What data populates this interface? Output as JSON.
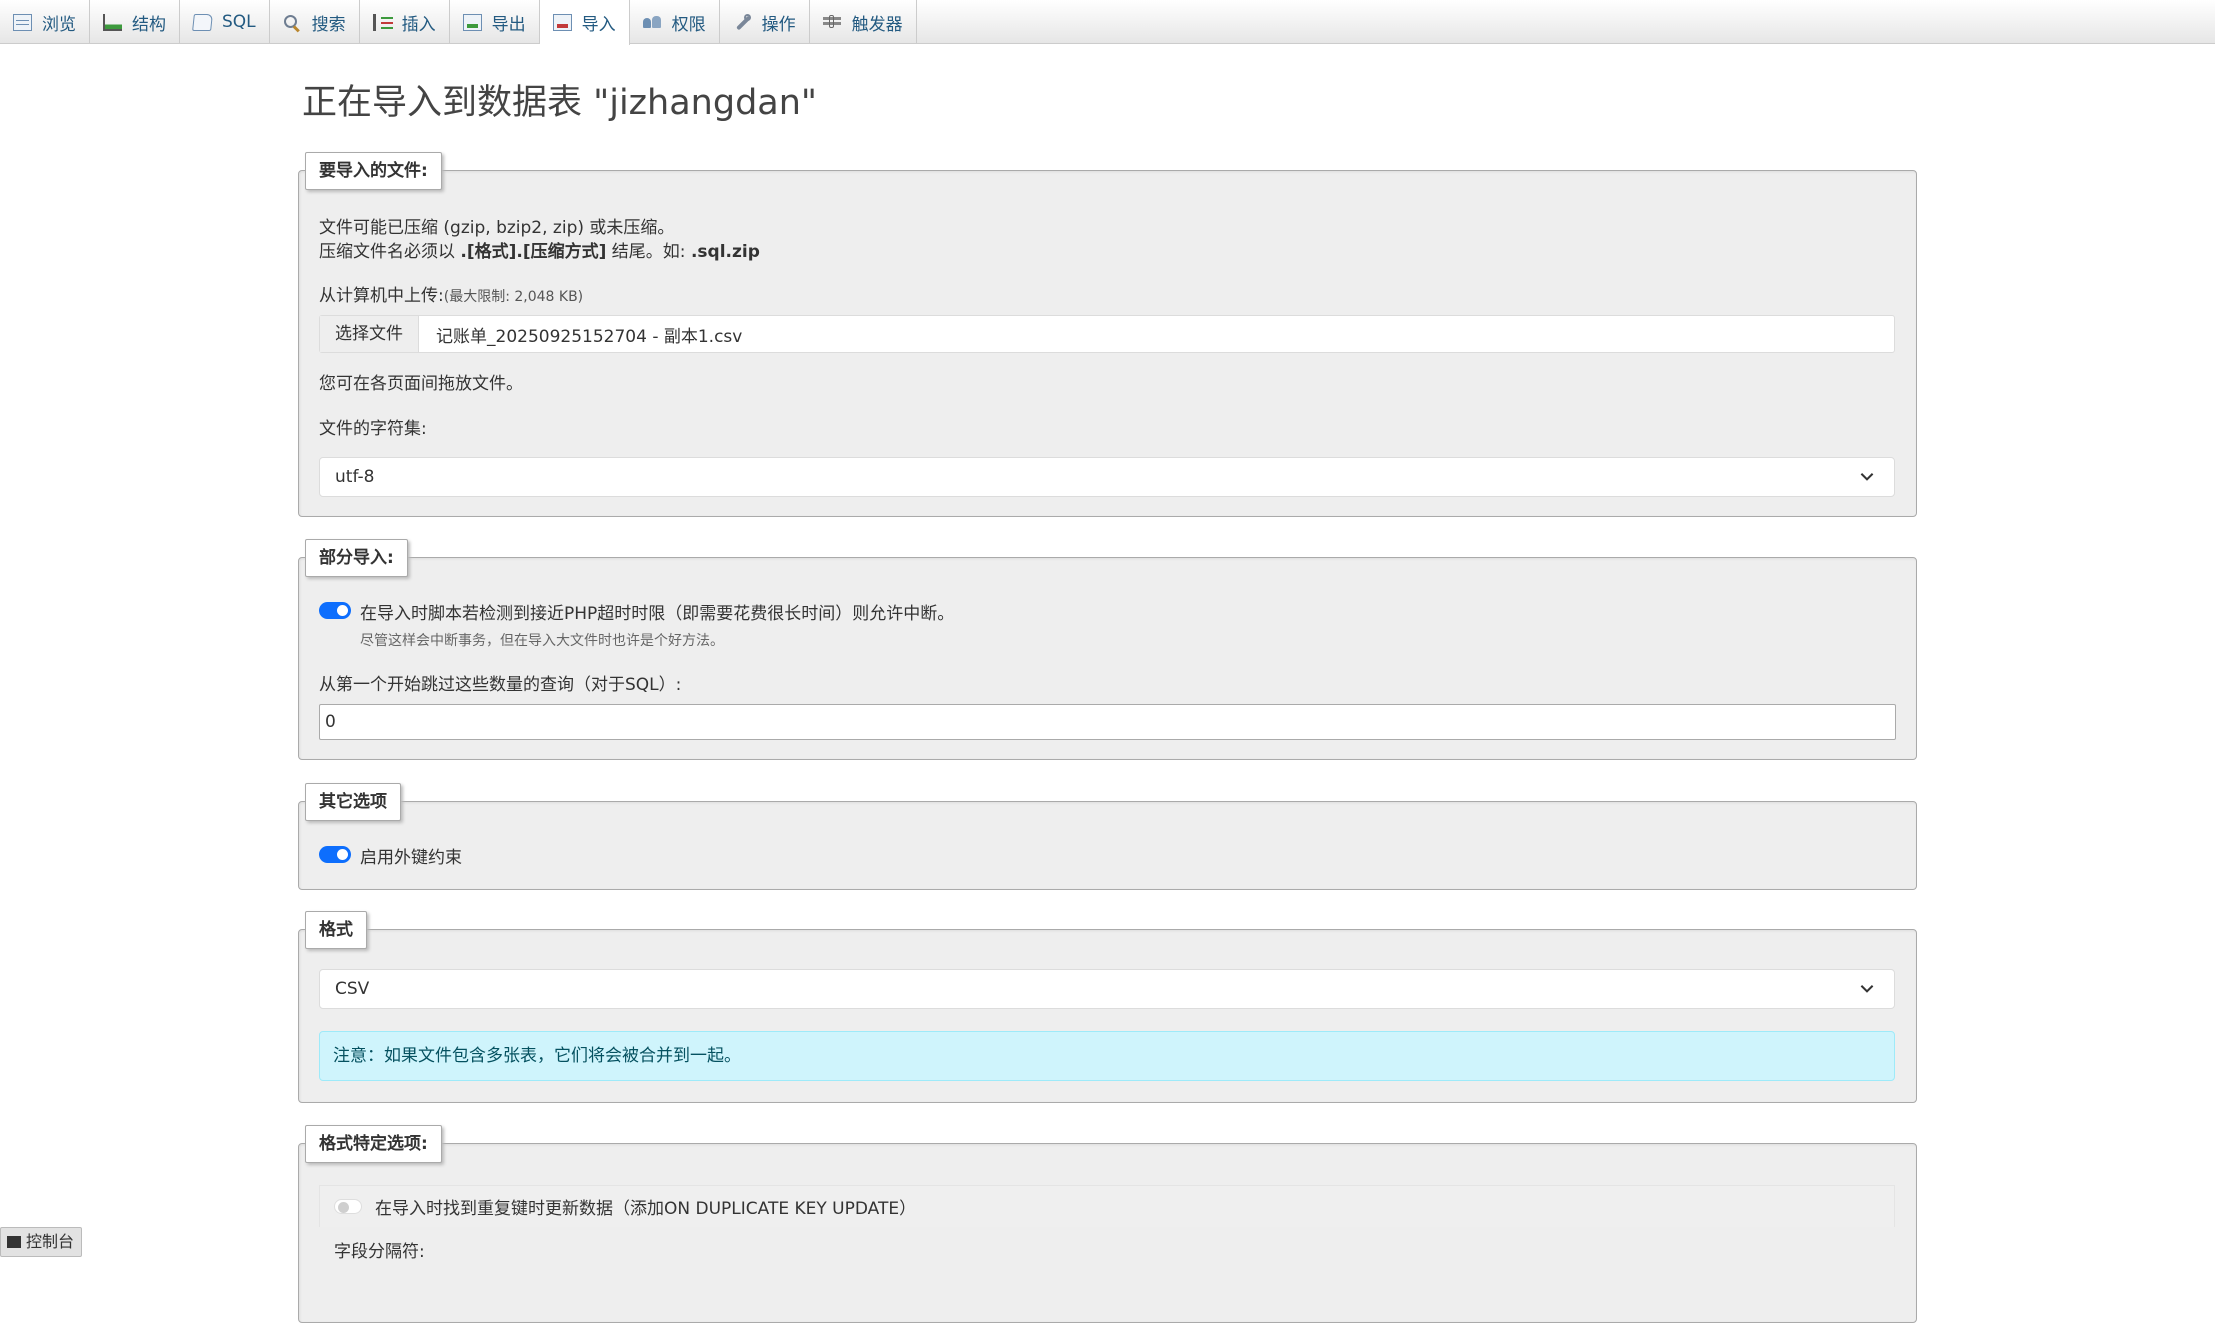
{
  "tabs": [
    {
      "label": "浏览",
      "icon": "browse-icon"
    },
    {
      "label": "结构",
      "icon": "structure-icon"
    },
    {
      "label": "SQL",
      "icon": "sql-icon"
    },
    {
      "label": "搜索",
      "icon": "search-icon"
    },
    {
      "label": "插入",
      "icon": "insert-icon"
    },
    {
      "label": "导出",
      "icon": "export-icon"
    },
    {
      "label": "导入",
      "icon": "import-icon",
      "active": true
    },
    {
      "label": "权限",
      "icon": "privileges-icon"
    },
    {
      "label": "操作",
      "icon": "operations-icon"
    },
    {
      "label": "触发器",
      "icon": "triggers-icon"
    }
  ],
  "page_title": "正在导入到数据表 \"jizhangdan\"",
  "file_section": {
    "legend": "要导入的文件:",
    "line1": "文件可能已压缩 (gzip, bzip2, zip) 或未压缩。",
    "line2_prefix": "压缩文件名必须以 ",
    "line2_bold1": ".[格式].[压缩方式]",
    "line2_mid": " 结尾。如: ",
    "line2_bold2": ".sql.zip",
    "upload_label": "从计算机中上传:",
    "upload_limit": "(最大限制: 2,048 KB)",
    "choose_file_button": "选择文件",
    "file_name": "记账单_20250925152704 - 副本1.csv",
    "drag_hint": "您可在各页面间拖放文件。",
    "charset_label": "文件的字符集:",
    "charset_value": "utf-8"
  },
  "partial_section": {
    "legend": "部分导入:",
    "allow_interrupt": "在导入时脚本若检测到接近PHP超时时限（即需要花费很长时间）则允许中断。",
    "allow_interrupt_hint": "尽管这样会中断事务，但在导入大文件时也许是个好方法。",
    "allow_interrupt_on": true,
    "skip_label": "从第一个开始跳过这些数量的查询（对于SQL）:",
    "skip_value": "0"
  },
  "other_section": {
    "legend": "其它选项",
    "fk_label": "启用外键约束",
    "fk_on": true
  },
  "format_section": {
    "legend": "格式",
    "format_value": "CSV",
    "notice": "注意：如果文件包含多张表，它们将会被合并到一起。"
  },
  "format_options_section": {
    "legend": "格式特定选项:",
    "update_dup_label": "在导入时找到重复键时更新数据（添加ON DUPLICATE KEY UPDATE）",
    "update_dup_on": false,
    "field_sep_label": "字段分隔符:"
  },
  "console": {
    "label": "控制台"
  },
  "colors": {
    "accent": "#0d6efd",
    "tab_text": "#235a81",
    "notice_bg": "#cff4fc",
    "panel_bg": "#eeeeee"
  }
}
